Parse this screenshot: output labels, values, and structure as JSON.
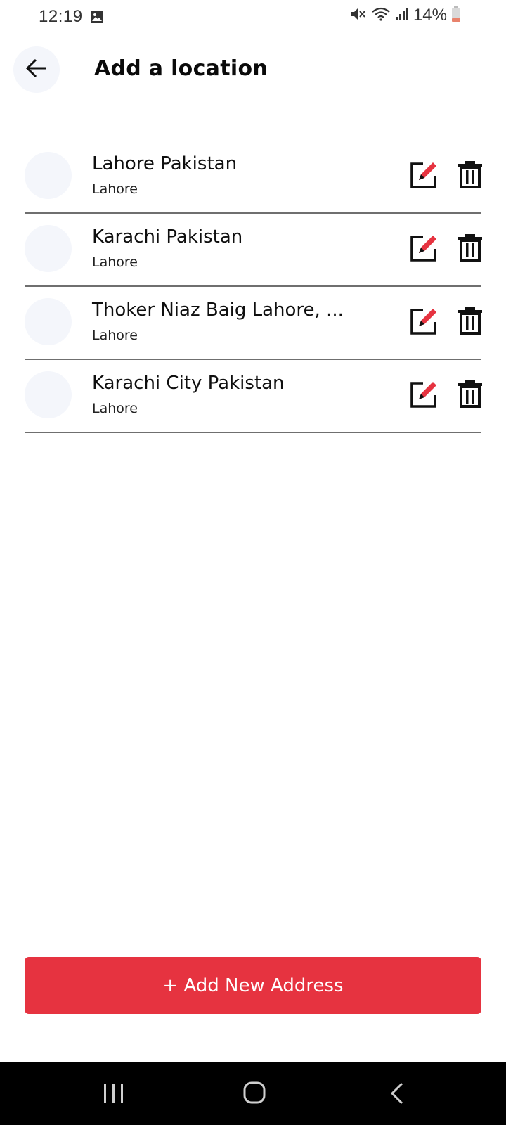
{
  "status_bar": {
    "time": "12:19",
    "battery_text": "14%",
    "icons": [
      "gallery-icon",
      "mute-icon",
      "wifi-icon",
      "signal-icon",
      "battery-icon"
    ]
  },
  "header": {
    "title": "Add a location",
    "back_icon": "arrow-left-icon"
  },
  "addresses": [
    {
      "title": "Lahore Pakistan",
      "subtitle": "Lahore"
    },
    {
      "title": "Karachi Pakistan",
      "subtitle": "Lahore"
    },
    {
      "title": "Thoker Niaz Baig Lahore, ...",
      "subtitle": "Lahore"
    },
    {
      "title": "Karachi City Pakistan",
      "subtitle": "Lahore"
    }
  ],
  "row_actions": {
    "edit_icon": "edit-icon",
    "delete_icon": "trash-icon"
  },
  "footer": {
    "add_button_label": "+ Add New Address"
  },
  "colors": {
    "accent": "#e63340",
    "avatar_bg": "#f4f6fb",
    "divider": "#6f6f6f",
    "nav_bar": "#000000"
  },
  "nav_bar": {
    "icons": [
      "recents-icon",
      "home-icon",
      "back-icon"
    ]
  }
}
